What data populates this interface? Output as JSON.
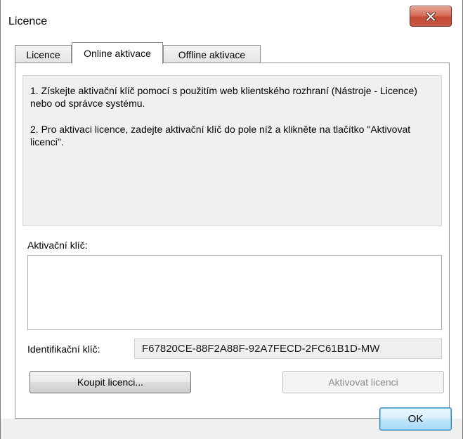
{
  "window": {
    "title": "Licence"
  },
  "tabs": [
    {
      "label": "Licence",
      "active": false
    },
    {
      "label": "Online aktivace",
      "active": true
    },
    {
      "label": "Offline aktivace",
      "active": false
    }
  ],
  "instructions": {
    "step1": "1. Získejte aktivační klíč pomocí s použitím web klientského rozhraní (Nástroje - Licence) nebo od správce systému.",
    "step2": "2. Pro aktivaci licence, zadejte aktivační klíč do pole níž a klikněte na tlačítko \"Aktivovat licenci\"."
  },
  "activation_key": {
    "label": "Aktivační klíč:",
    "value": ""
  },
  "identification_key": {
    "label": "Identifikační klíč:",
    "value": "F67820CE-88F2A88F-92A7FECD-2FC61B1D-MW"
  },
  "buttons": {
    "buy": "Koupit licenci...",
    "activate": "Aktivovat licenci",
    "ok": "OK"
  },
  "icons": {
    "close": "close-icon"
  },
  "colors": {
    "close_button": "#c44a33",
    "info_background": "#f0f0f0",
    "ok_button_border": "#3c7fb1",
    "disabled_text": "#8d8d8d"
  }
}
